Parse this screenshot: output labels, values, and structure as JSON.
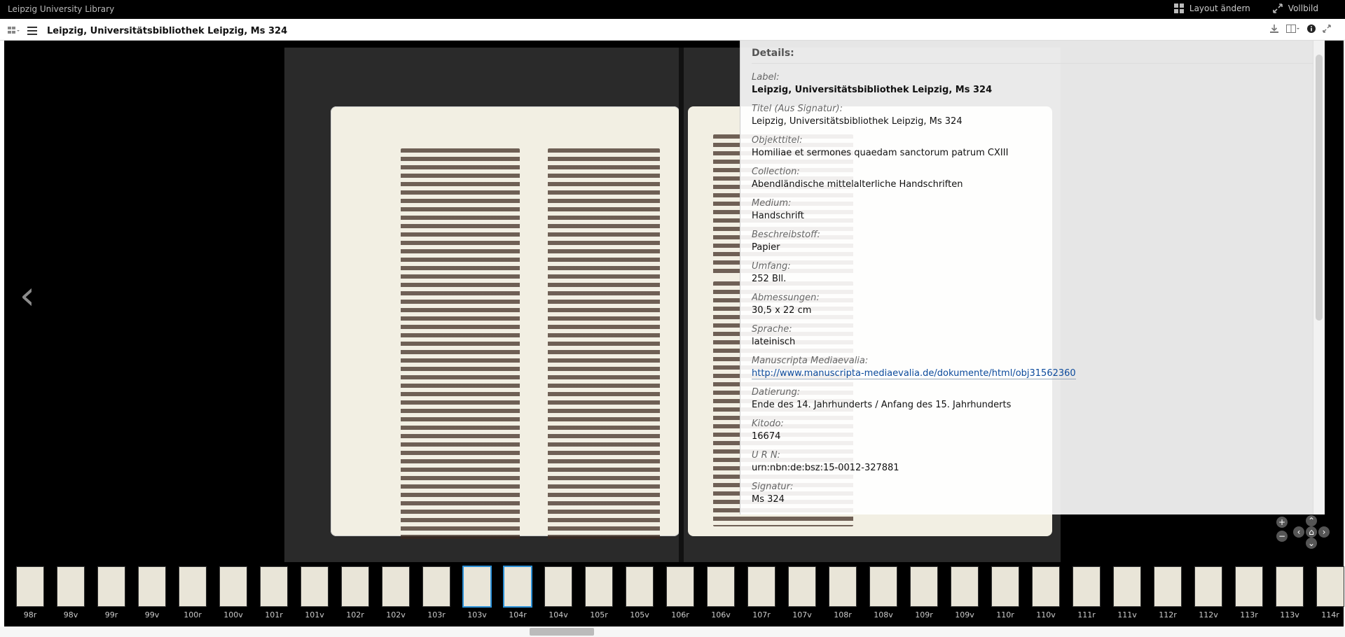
{
  "app": {
    "brand": "Leipzig University Library",
    "actions": {
      "layout": "Layout ändern",
      "fullscreen": "Vollbild"
    }
  },
  "titlebar": {
    "title": "Leipzig, Universitätsbibliothek Leipzig, Ms 324"
  },
  "details": {
    "heading": "Details:",
    "items": [
      {
        "k": "Label:",
        "v": "Leipzig, Universitätsbibliothek Leipzig, Ms 324",
        "bold": true
      },
      {
        "k": "Titel (Aus Signatur):",
        "v": "Leipzig, Universitätsbibliothek Leipzig, Ms 324"
      },
      {
        "k": "Objekttitel:",
        "v": "Homiliae et sermones quaedam sanctorum patrum CXIII"
      },
      {
        "k": "Collection:",
        "v": "Abendländische mittelalterliche Handschriften"
      },
      {
        "k": "Medium:",
        "v": "Handschrift"
      },
      {
        "k": "Beschreibstoff:",
        "v": "Papier"
      },
      {
        "k": "Umfang:",
        "v": "252 Bll."
      },
      {
        "k": "Abmessungen:",
        "v": "30,5 x 22 cm"
      },
      {
        "k": "Sprache:",
        "v": "lateinisch"
      },
      {
        "k": "Manuscripta Mediaevalia:",
        "v": "http://www.manuscripta-mediaevalia.de/dokumente/html/obj31562360",
        "link": true
      },
      {
        "k": "Datierung:",
        "v": "Ende des 14. Jahrhunderts / Anfang des 15. Jahrhunderts"
      },
      {
        "k": "Kitodo:",
        "v": "16674"
      },
      {
        "k": "U R N:",
        "v": "urn:nbn:de:bsz:15-0012-327881"
      },
      {
        "k": "Signatur:",
        "v": "Ms 324"
      }
    ]
  },
  "thumbnails": [
    {
      "label": "98r"
    },
    {
      "label": "98v"
    },
    {
      "label": "99r"
    },
    {
      "label": "99v"
    },
    {
      "label": "100r"
    },
    {
      "label": "100v"
    },
    {
      "label": "101r"
    },
    {
      "label": "101v"
    },
    {
      "label": "102r"
    },
    {
      "label": "102v"
    },
    {
      "label": "103r"
    },
    {
      "label": "103v",
      "selected": true
    },
    {
      "label": "104r",
      "selected": true
    },
    {
      "label": "104v"
    },
    {
      "label": "105r"
    },
    {
      "label": "105v"
    },
    {
      "label": "106r"
    },
    {
      "label": "106v"
    },
    {
      "label": "107r"
    },
    {
      "label": "107v"
    },
    {
      "label": "108r"
    },
    {
      "label": "108v"
    },
    {
      "label": "109r"
    },
    {
      "label": "109v"
    },
    {
      "label": "110r"
    },
    {
      "label": "110v"
    },
    {
      "label": "111r"
    },
    {
      "label": "111v"
    },
    {
      "label": "112r"
    },
    {
      "label": "112v"
    },
    {
      "label": "113r"
    },
    {
      "label": "113v"
    },
    {
      "label": "114r"
    }
  ],
  "colors": {
    "selection": "#2b8fd6",
    "link": "#0b4a9c"
  }
}
